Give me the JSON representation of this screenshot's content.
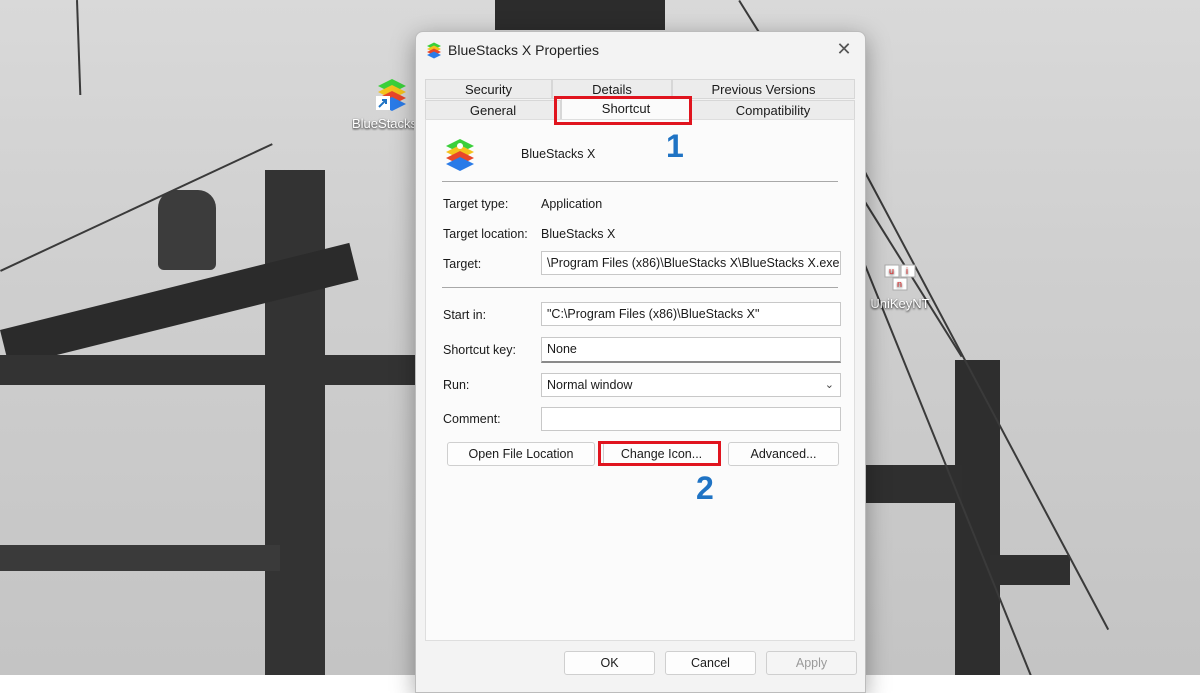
{
  "desktop": {
    "icons": [
      {
        "label": "BlueStacks X"
      },
      {
        "label": "UniKeyNT"
      }
    ]
  },
  "dialog": {
    "title": "BlueStacks X Properties",
    "close_glyph": "✕",
    "tabs_row1": [
      "Security",
      "Details",
      "Previous Versions"
    ],
    "tabs_row2": [
      "General",
      "Shortcut",
      "Compatibility"
    ],
    "active_tab": "Shortcut",
    "app_name": "BlueStacks X",
    "fields": {
      "target_type_label": "Target type:",
      "target_type_value": "Application",
      "target_location_label": "Target location:",
      "target_location_value": "BlueStacks X",
      "target_label": "Target:",
      "target_value": "\\Program Files (x86)\\BlueStacks X\\BlueStacks X.exe\"",
      "start_in_label": "Start in:",
      "start_in_value": "\"C:\\Program Files (x86)\\BlueStacks X\"",
      "shortcut_key_label": "Shortcut key:",
      "shortcut_key_value": "None",
      "run_label": "Run:",
      "run_value": "Normal window",
      "comment_label": "Comment:",
      "comment_value": ""
    },
    "buttons": {
      "open_file_location": "Open File Location",
      "change_icon": "Change Icon...",
      "advanced": "Advanced...",
      "ok": "OK",
      "cancel": "Cancel",
      "apply": "Apply"
    }
  },
  "annotations": {
    "step1": "1",
    "step2": "2",
    "highlight_color": "#e0141e",
    "step_color": "#1f73c4"
  }
}
